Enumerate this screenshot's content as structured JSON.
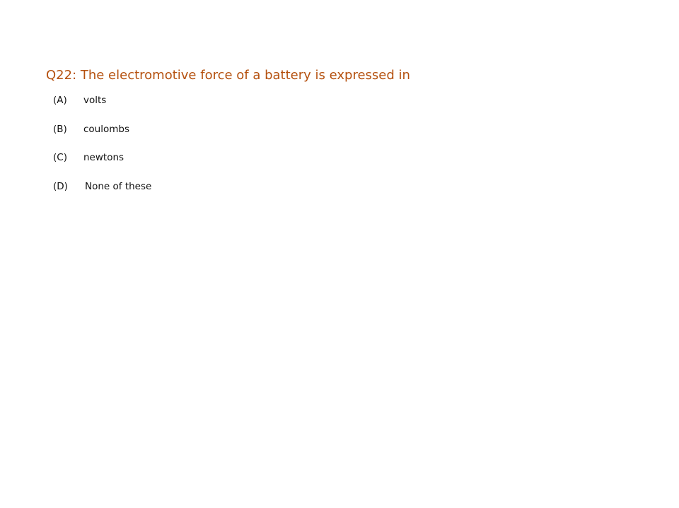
{
  "question": {
    "text": "Q22: The electromotive force of a battery is expressed in",
    "color": "#b5510f"
  },
  "options": [
    {
      "letter": "(A)",
      "text": "volts"
    },
    {
      "letter": "(B)",
      "text": "coulombs"
    },
    {
      "letter": "(C)",
      "text": "newtons"
    },
    {
      "letter": "(D)",
      "text": "None of these"
    }
  ]
}
